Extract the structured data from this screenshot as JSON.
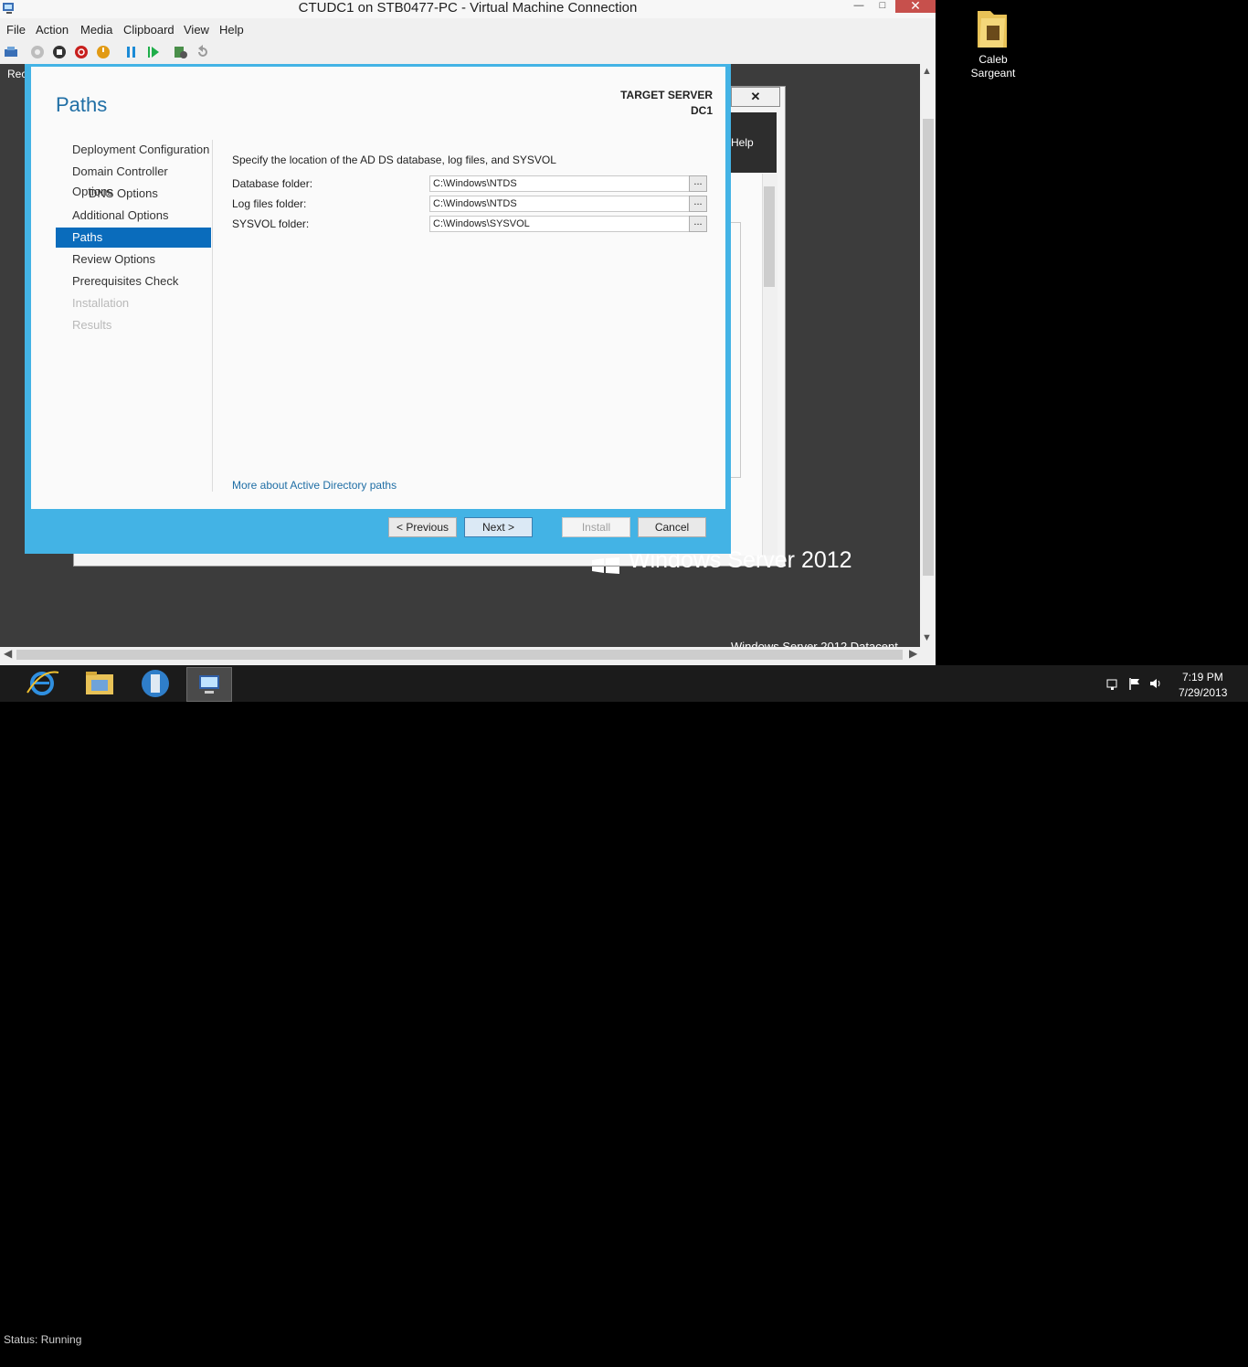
{
  "window": {
    "title": "CTUDC1 on STB0477-PC - Virtual Machine Connection",
    "minimize": "—",
    "maximize": "□",
    "close": "✕"
  },
  "menu": [
    "File",
    "Action",
    "Media",
    "Clipboard",
    "View",
    "Help"
  ],
  "guest": {
    "partial_text": "Rec",
    "logo_text": "Windows Server 2012",
    "bottom_text": "Windows Server 2012 Datacent",
    "server_manager": {
      "close": "✕",
      "help": "Help"
    }
  },
  "wizard": {
    "title": "Paths",
    "target_server_label": "TARGET SERVER",
    "target_server_name": "DC1",
    "nav": [
      {
        "label": "Deployment Configuration"
      },
      {
        "label": "Domain Controller Options"
      },
      {
        "label": "DNS Options"
      },
      {
        "label": "Additional Options"
      },
      {
        "label": "Paths"
      },
      {
        "label": "Review Options"
      },
      {
        "label": "Prerequisites Check"
      },
      {
        "label": "Installation"
      },
      {
        "label": "Results"
      }
    ],
    "instruction": "Specify the location of the AD DS database, log files, and SYSVOL",
    "fields": [
      {
        "label": "Database folder:",
        "value": "C:\\Windows\\NTDS"
      },
      {
        "label": "Log files folder:",
        "value": "C:\\Windows\\NTDS"
      },
      {
        "label": "SYSVOL folder:",
        "value": "C:\\Windows\\SYSVOL"
      }
    ],
    "browse_label": "...",
    "more_link": "More about Active Directory paths",
    "buttons": {
      "previous": "< Previous",
      "next": "Next >",
      "install": "Install",
      "cancel": "Cancel"
    }
  },
  "status": {
    "text": "Status: Running"
  },
  "desktop": {
    "folder_label_line1": "Caleb",
    "folder_label_line2": "Sargeant"
  },
  "clock": {
    "time": "7:19 PM",
    "date": "7/29/2013"
  },
  "colors": {
    "wizard_border": "#43b3e5",
    "nav_active": "#0a6cbc",
    "title_blue": "#1f6ea5"
  }
}
